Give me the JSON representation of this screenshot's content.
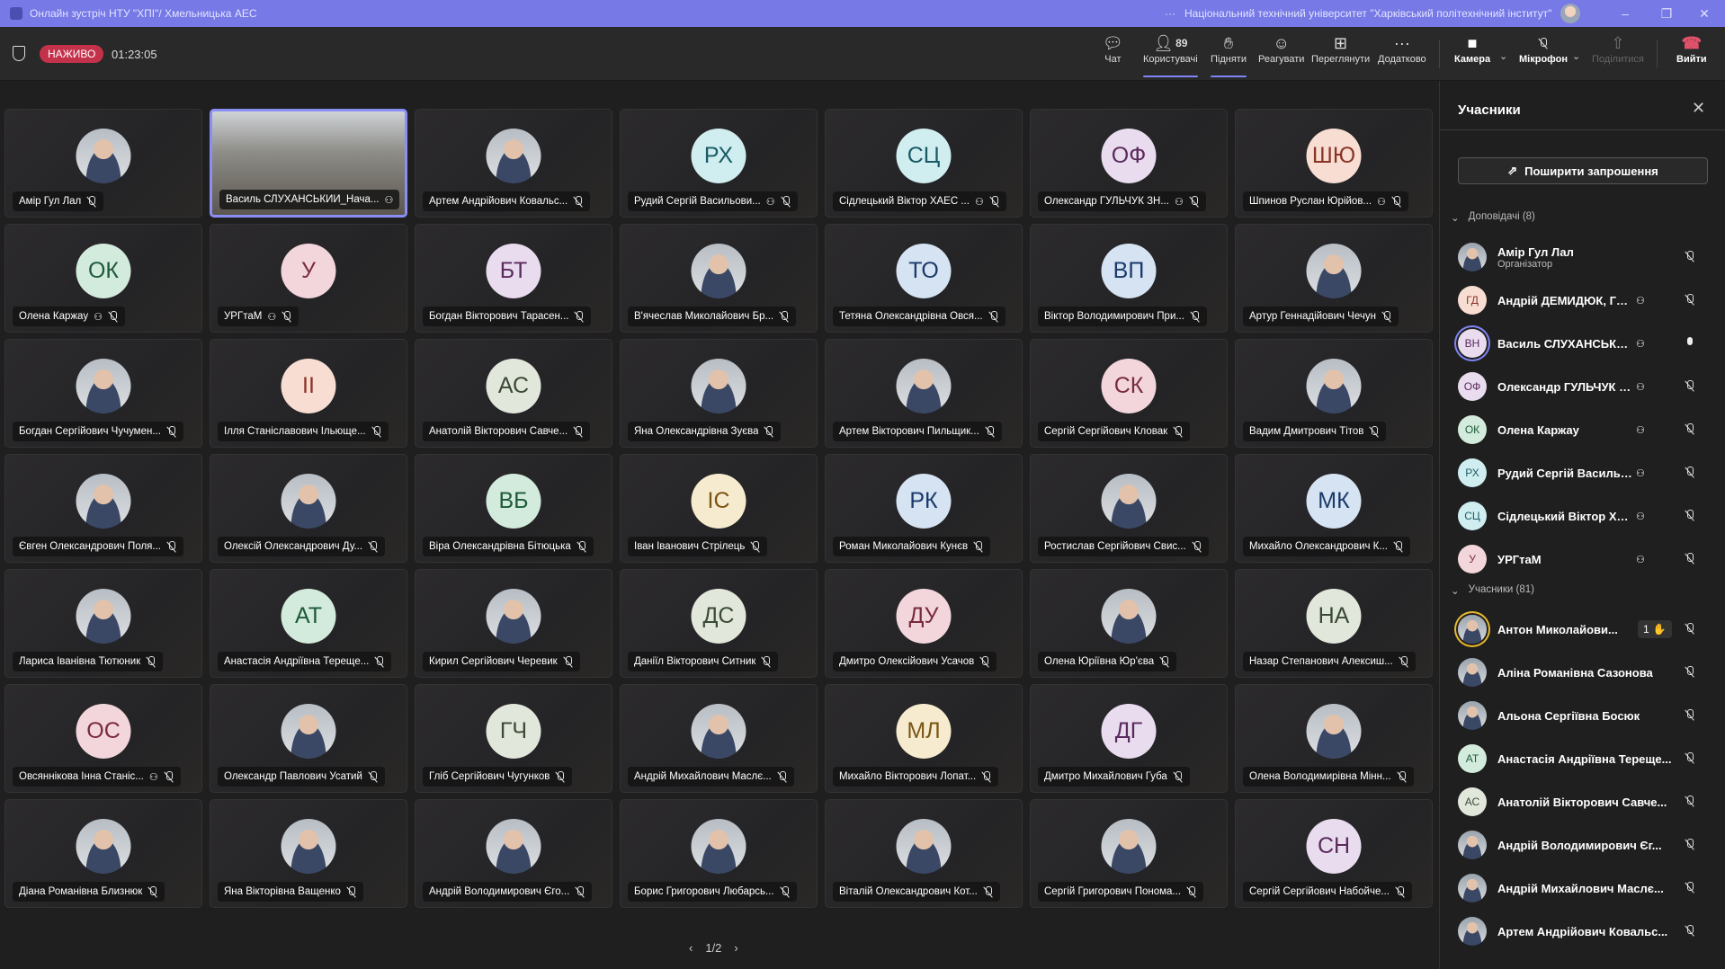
{
  "titlebar": {
    "title": "Онлайн зустріч НТУ \"ХПІ\"/ Хмельницька АЕС",
    "more": "···",
    "organization": "Національний технічний університет \"Харківський політехнічний інститут\"",
    "minimize": "–",
    "restore": "❐",
    "close": "✕"
  },
  "toolbar": {
    "live_badge": "НАЖИВО",
    "timer": "01:23:05",
    "chat": "Чат",
    "people": "Користувачі",
    "people_count": "89",
    "raise": "Підняти",
    "react": "Реагувати",
    "view": "Переглянути",
    "more": "Додатково",
    "camera": "Камера",
    "mic": "Мікрофон",
    "share": "Поділитися",
    "leave": "Вийти"
  },
  "colors": {
    "accent": "#7f85f5",
    "live": "#c4314b",
    "leave": "#e0526a",
    "titlebar": "#7679e6"
  },
  "palette": {
    "green": [
      "#d3ebdc",
      "#1d5a39"
    ],
    "pink": [
      "#f2d6dc",
      "#7a2b3b"
    ],
    "lavender": [
      "#e8dcee",
      "#5b2a5d"
    ],
    "blue": [
      "#d5e3f2",
      "#1b3a6b"
    ],
    "cyan": [
      "#d0eef0",
      "#1a5a66"
    ],
    "peach": [
      "#f8ddd2",
      "#8a3428"
    ],
    "beige": [
      "#f7ebcf",
      "#7a5514"
    ],
    "sage": [
      "#e1e7db",
      "#3a4a36"
    ]
  },
  "tiles": [
    {
      "name": "Амір Гул Лал",
      "photo": true
    },
    {
      "name": "Василь СЛУХАНСЬКИЙ_Нача...",
      "video": true,
      "ext": true,
      "active": true
    },
    {
      "name": "Артем Андрійович Ковальс...",
      "photo": true
    },
    {
      "name": "Рудий Сергій Васильови...",
      "initials": "РХ",
      "color": "cyan",
      "ext": true
    },
    {
      "name": "Сідлецький Віктор ХАЕС ...",
      "initials": "СЦ",
      "color": "cyan",
      "ext": true
    },
    {
      "name": "Олександр ГУЛЬЧУК ЗН...",
      "initials": "ОФ",
      "color": "lavender",
      "ext": true
    },
    {
      "name": "Шпинов Руслан Юрійов...",
      "initials": "ШЮ",
      "color": "peach",
      "ext": true
    },
    {
      "name": "Олена Каржау",
      "initials": "ОК",
      "color": "green",
      "ext": true
    },
    {
      "name": "УРГтаМ",
      "initials": "У",
      "color": "pink",
      "ext": true
    },
    {
      "name": "Богдан Вікторович Тарасен...",
      "initials": "БТ",
      "color": "lavender"
    },
    {
      "name": "В'ячеслав Миколайович Бр...",
      "photo": true
    },
    {
      "name": "Тетяна Олександрівна Овся...",
      "initials": "ТО",
      "color": "blue"
    },
    {
      "name": "Віктор Володимирович При...",
      "initials": "ВП",
      "color": "blue"
    },
    {
      "name": "Артур Геннадійович Чечун",
      "photo": true
    },
    {
      "name": "Богдан Сергійович Чучумен...",
      "photo": true
    },
    {
      "name": "Ілля Станіславович Ільюще...",
      "initials": "ІІ",
      "color": "peach"
    },
    {
      "name": "Анатолій Вікторович Савче...",
      "initials": "АС",
      "color": "sage"
    },
    {
      "name": "Яна Олександрівна Зуєва",
      "photo": true
    },
    {
      "name": "Артем Вікторович Пильщик...",
      "photo": true
    },
    {
      "name": "Сергій Сергійович Кловак",
      "initials": "СК",
      "color": "pink"
    },
    {
      "name": "Вадим Дмитрович Тітов",
      "photo": true
    },
    {
      "name": "Євген Олександрович Поля...",
      "photo": true
    },
    {
      "name": "Олексій Олександрович Ду...",
      "photo": true
    },
    {
      "name": "Віра Олександрівна Бітюцька",
      "initials": "ВБ",
      "color": "green"
    },
    {
      "name": "Іван Іванович Стрілець",
      "initials": "ІС",
      "color": "beige"
    },
    {
      "name": "Роман Миколайович Кунєв",
      "initials": "РК",
      "color": "blue"
    },
    {
      "name": "Ростислав Сергійович Свис...",
      "photo": true
    },
    {
      "name": "Михайло Олександрович К...",
      "initials": "МК",
      "color": "blue"
    },
    {
      "name": "Лариса Іванівна Тютюник",
      "photo": true
    },
    {
      "name": "Анастасія Андріївна Терещe...",
      "initials": "АТ",
      "color": "green"
    },
    {
      "name": "Кирил Сергійович Черевик",
      "photo": true
    },
    {
      "name": "Даніїл Вікторович Ситник",
      "initials": "ДС",
      "color": "sage"
    },
    {
      "name": "Дмитро Олексійович Усачов",
      "initials": "ДУ",
      "color": "pink"
    },
    {
      "name": "Олена Юріївна Юр'єва",
      "photo": true
    },
    {
      "name": "Назар Степанович Алексиш...",
      "initials": "НА",
      "color": "sage"
    },
    {
      "name": "Овсяннікова Інна Станіс...",
      "initials": "ОС",
      "color": "pink",
      "ext": true
    },
    {
      "name": "Олександр Павлович Усатий",
      "photo": true
    },
    {
      "name": "Гліб Сергійович Чугунков",
      "initials": "ГЧ",
      "color": "sage"
    },
    {
      "name": "Андрій Михайлович Маслє...",
      "photo": true
    },
    {
      "name": "Михайло Вікторович Лопат...",
      "initials": "МЛ",
      "color": "beige"
    },
    {
      "name": "Дмитро Михайлович Губа",
      "initials": "ДГ",
      "color": "lavender"
    },
    {
      "name": "Олена Володимирівна Мінн...",
      "photo": true
    },
    {
      "name": "Діана Романівна Близнюк",
      "photo": true
    },
    {
      "name": "Яна Вікторівна Ващенко",
      "photo": true
    },
    {
      "name": "Андрій Володимирович Єго...",
      "photo": true
    },
    {
      "name": "Борис Григорович Любарсь...",
      "photo": true
    },
    {
      "name": "Віталій Олександрович Кот...",
      "photo": true
    },
    {
      "name": "Сергій Григорович Понома...",
      "photo": true
    },
    {
      "name": "Сергій Сергійович Набойче...",
      "initials": "СН",
      "color": "lavender"
    }
  ],
  "pager": {
    "prev": "‹",
    "page": "1/2",
    "next": "›"
  },
  "sidebar": {
    "title": "Учасники",
    "invite": "Поширити запрошення",
    "presenters_header": "Доповідачі (8)",
    "attendees_header": "Учасники (81)",
    "presenters": [
      {
        "name": "Амір Гул Лал",
        "role": "Організатор",
        "photo": true
      },
      {
        "name": "Андрій ДЕМИДЮК, ГТЦ, ...",
        "initials": "ГД",
        "color": "peach",
        "ext": true
      },
      {
        "name": "Василь СЛУХАНСЬКИЙ_...",
        "initials": "ВН",
        "color": "lavender",
        "ext": true,
        "speaking": true
      },
      {
        "name": "Олександр ГУЛЬЧУК ЗН...",
        "initials": "ОФ",
        "color": "lavender",
        "ext": true
      },
      {
        "name": "Олена Каржау",
        "initials": "ОК",
        "color": "green",
        "ext": true
      },
      {
        "name": "Рудий Сергій Васильови...",
        "initials": "РХ",
        "color": "cyan",
        "ext": true
      },
      {
        "name": "Сідлецький Віктор ХАЕС ...",
        "initials": "СЦ",
        "color": "cyan",
        "ext": true
      },
      {
        "name": "УРГтаМ",
        "initials": "У",
        "color": "pink",
        "ext": true
      }
    ],
    "attendees": [
      {
        "name": "Антон Миколайови...",
        "photo": true,
        "hand": "1"
      },
      {
        "name": "Аліна Романівна Сазонова",
        "photo": true
      },
      {
        "name": "Альона Сергіївна Босюк",
        "photo": true
      },
      {
        "name": "Анастасія Андріївна Тереще...",
        "initials": "АТ",
        "color": "green"
      },
      {
        "name": "Анатолій Вікторович Савче...",
        "initials": "АС",
        "color": "sage"
      },
      {
        "name": "Андрій Володимирович Єг...",
        "photo": true
      },
      {
        "name": "Андрій Михайлович Маслє...",
        "photo": true
      },
      {
        "name": "Артем Андрійович Ковальс...",
        "photo": true
      }
    ]
  }
}
